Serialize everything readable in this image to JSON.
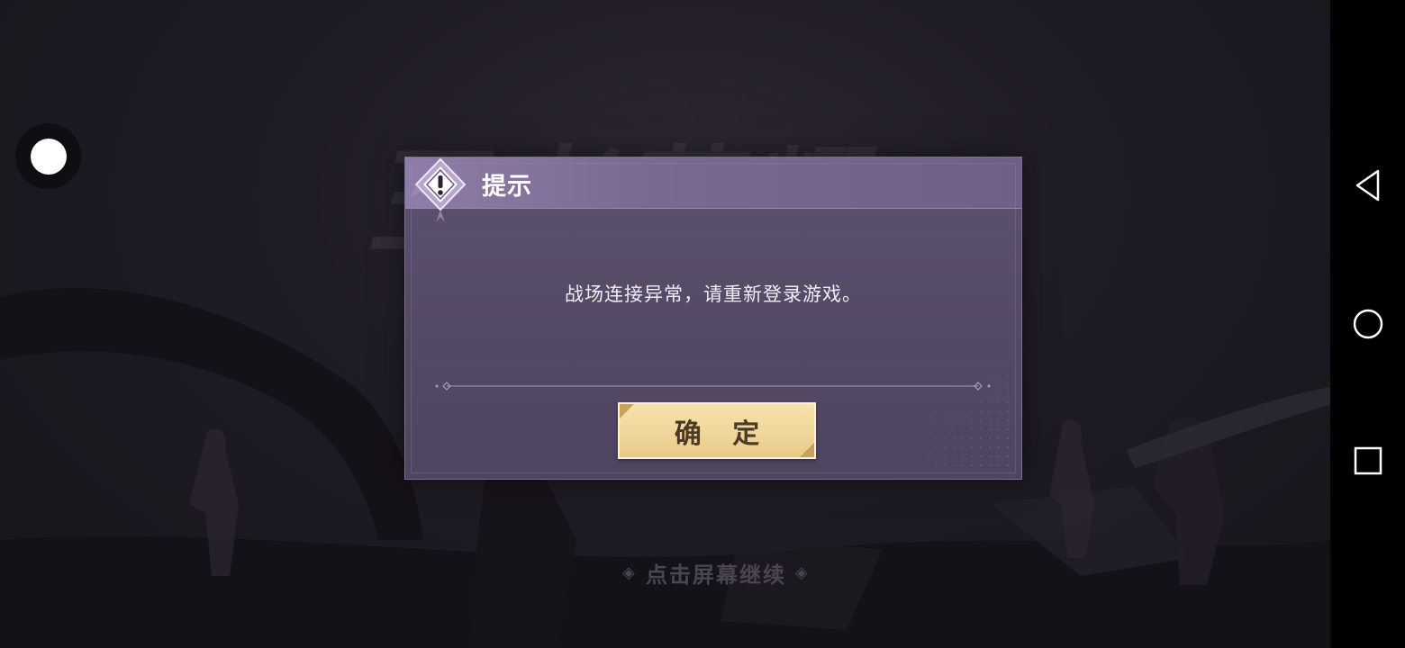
{
  "game": {
    "background_title": "王者荣耀",
    "continue_hint": "点击屏幕继续",
    "hint_left_ornament": "◈",
    "hint_right_ornament": "◈"
  },
  "dialog": {
    "title": "提示",
    "icon": "exclamation-icon",
    "message": "战场连接异常，请重新登录游戏。",
    "confirm_label": "确 定",
    "colors": {
      "header": "#8f7ca8",
      "body": "#554a66",
      "button": "#f0d69a",
      "button_text": "#4b3a26"
    }
  },
  "system": {
    "assistive_touch_icon": "assistive-touch-icon",
    "nav_bar": {
      "back_icon": "back-triangle-icon",
      "home_icon": "home-circle-icon",
      "recent_icon": "recent-square-icon"
    }
  }
}
